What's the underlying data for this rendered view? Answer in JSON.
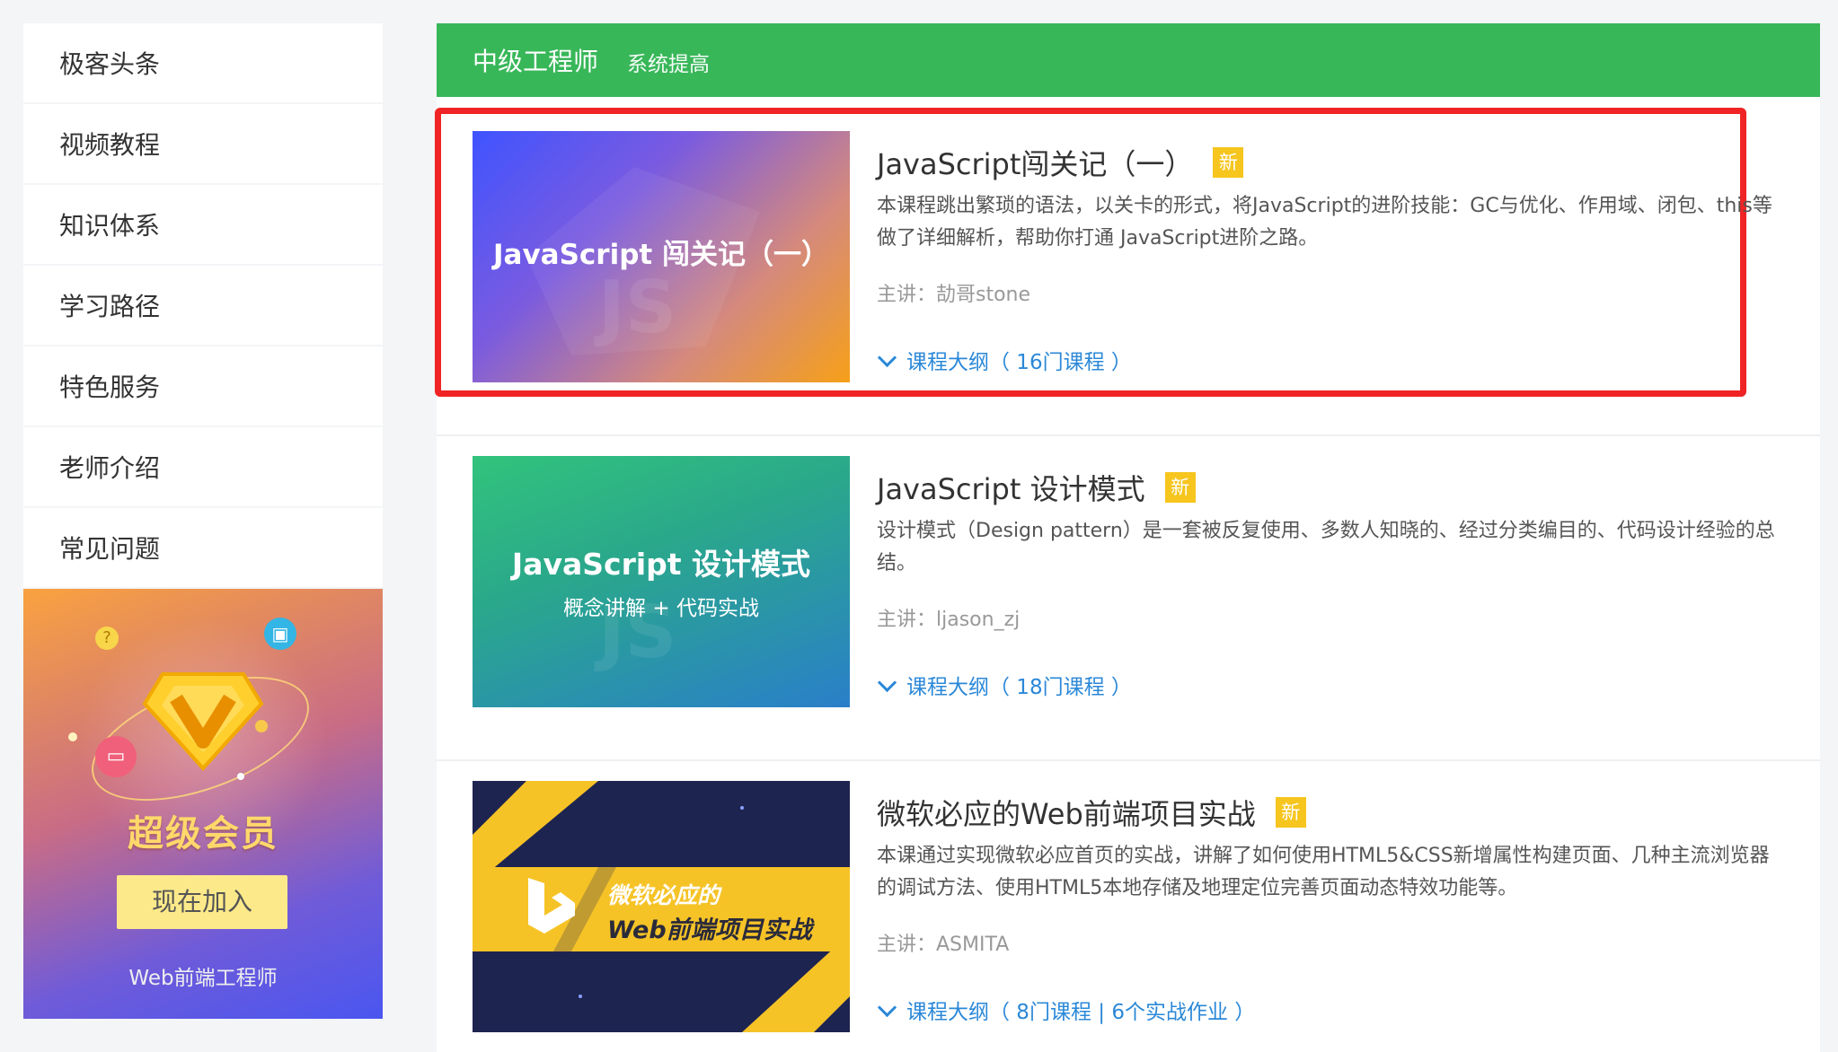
{
  "sidebar": {
    "items": [
      {
        "label": "极客头条"
      },
      {
        "label": "视频教程"
      },
      {
        "label": "知识体系"
      },
      {
        "label": "学习路径"
      },
      {
        "label": "特色服务"
      },
      {
        "label": "老师介绍"
      },
      {
        "label": "常见问题"
      }
    ]
  },
  "vip": {
    "title": "超级会员",
    "join_label": "现在加入",
    "subtitle": "Web前端工程师"
  },
  "header": {
    "title": "中级工程师",
    "subtitle": "系统提高",
    "color": "#38b759"
  },
  "courses": [
    {
      "title": "JavaScript闯关记（一）",
      "tag": "新",
      "description": "本课程跳出繁琐的语法，以关卡的形式，将JavaScript的进阶技能：GC与优化、作用域、闭包、this等做了详细解析，帮助你打通 JavaScript进阶之路。",
      "teacher": "主讲：劼哥stone",
      "outline": "课程大纲（ 16门课程 ）",
      "thumb_title": "JavaScript 闯关记（一）",
      "highlighted": true
    },
    {
      "title": "JavaScript 设计模式",
      "tag": "新",
      "description": "设计模式（Design pattern）是一套被反复使用、多数人知晓的、经过分类编目的、代码设计经验的总结。",
      "teacher": "主讲：ljason_zj",
      "outline": "课程大纲（ 18门课程 ）",
      "thumb_title": "JavaScript 设计模式",
      "thumb_sub": "概念讲解 + 代码实战"
    },
    {
      "title": "微软必应的Web前端项目实战",
      "tag": "新",
      "description": "本课通过实现微软必应首页的实战，讲解了如何使用HTML5&CSS新增属性构建页面、几种主流浏览器的调试方法、使用HTML5本地存储及地理定位完善页面动态特效功能等。",
      "teacher": "主讲：ASMITA",
      "outline": "课程大纲（ 8门课程 | 6个实战作业 ）",
      "thumb_line1": "微软必应的",
      "thumb_line2": "Web前端项目实战"
    }
  ],
  "colors": {
    "highlight_border": "#f02424",
    "tag": "#f6c51e",
    "link": "#2b88d8"
  }
}
